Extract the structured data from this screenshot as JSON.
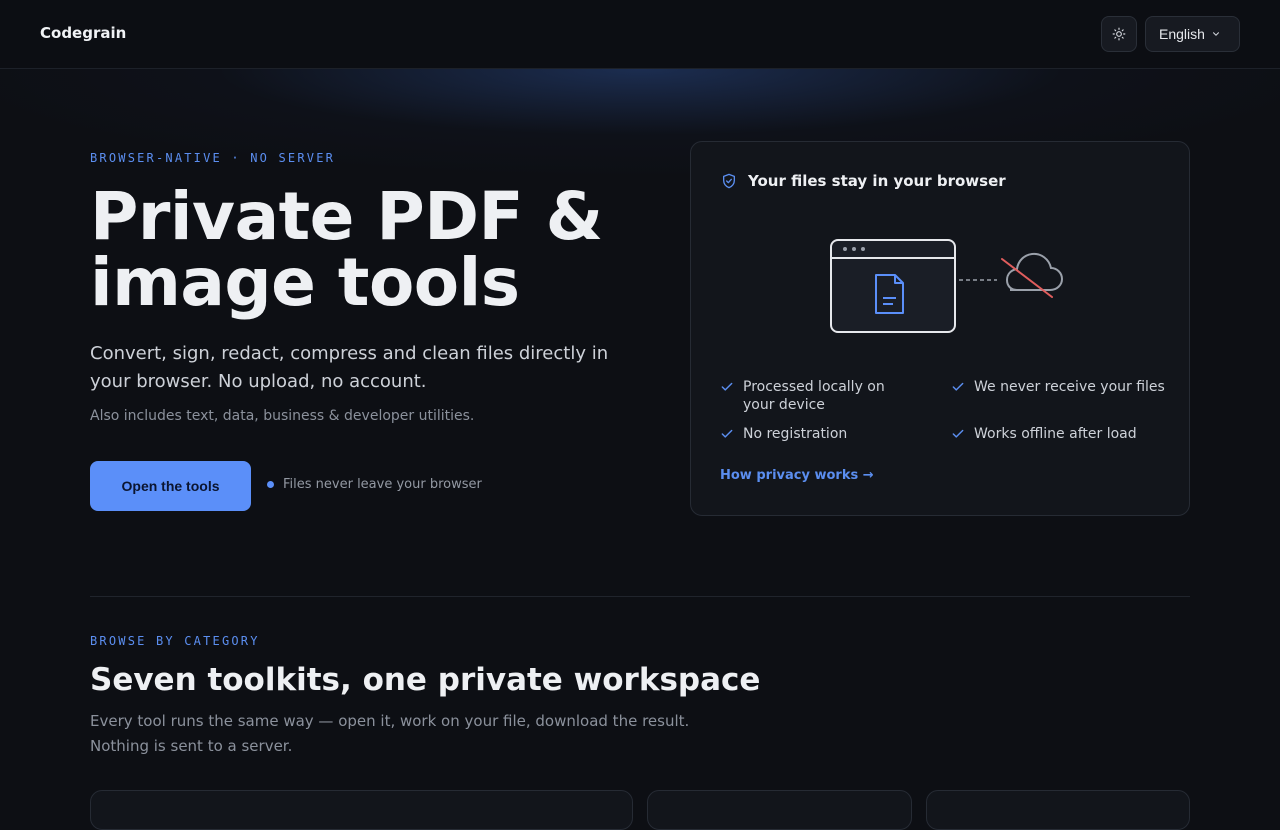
{
  "header": {
    "brand": "Codegrain",
    "theme_icon": "sun-icon",
    "language": "English",
    "language_icon": "chevron-down-icon"
  },
  "hero": {
    "eyebrow": "BROWSER-NATIVE · NO SERVER",
    "title": "Private PDF & image tools",
    "lead": "Convert, sign, redact, compress and clean files directly in your browser. No upload, no account.",
    "sub": "Also includes text, data, business & developer utilities.",
    "cta_label": "Open the tools",
    "cta_note": "Files never leave your browser"
  },
  "privacy_card": {
    "icon": "shield-check-icon",
    "title": "Your files stay in your browser",
    "features": [
      "Processed locally on your device",
      "We never receive your files",
      "No registration",
      "Works offline after load"
    ],
    "link": "How privacy works →"
  },
  "categories": {
    "eyebrow": "BROWSE BY CATEGORY",
    "title": "Seven toolkits, one private workspace",
    "description": "Every tool runs the same way — open it, work on your file, download the result. Nothing is sent to a server."
  },
  "colors": {
    "accent": "#5b8ff9",
    "background": "#0d0f14",
    "card": "#12151b",
    "strike": "#e05d5d"
  }
}
